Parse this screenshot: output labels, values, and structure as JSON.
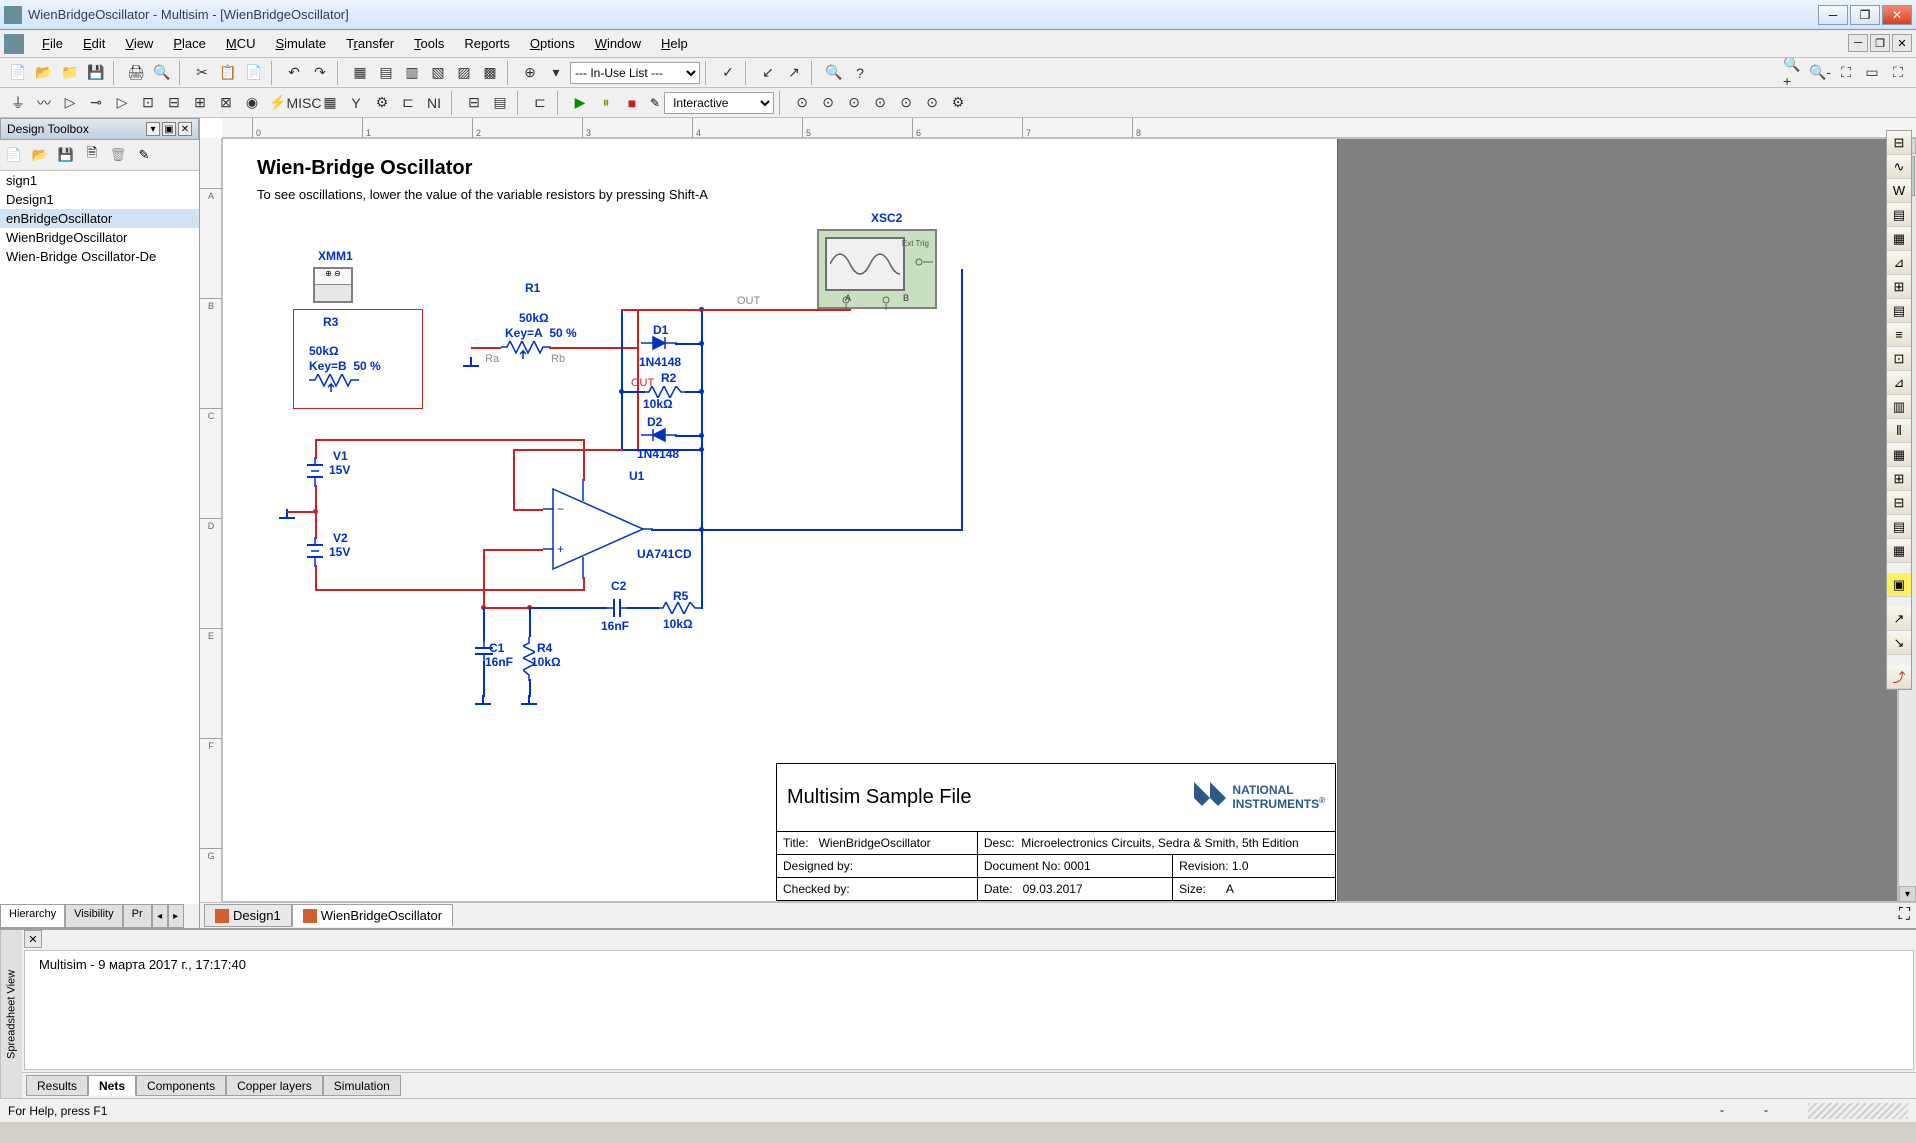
{
  "window": {
    "title": "WienBridgeOscillator - Multisim - [WienBridgeOscillator]"
  },
  "menu": {
    "items": [
      "File",
      "Edit",
      "View",
      "Place",
      "MCU",
      "Simulate",
      "Transfer",
      "Tools",
      "Reports",
      "Options",
      "Window",
      "Help"
    ]
  },
  "toolbar1": {
    "in_use": "--- In-Use List ---"
  },
  "toolbar2": {
    "interactive": "Interactive"
  },
  "sidebar": {
    "title": "Design Toolbox",
    "items": [
      "sign1",
      "Design1",
      "enBridgeOscillator",
      "WienBridgeOscillator",
      "Wien-Bridge Oscillator-De"
    ],
    "selected": 2,
    "tabs": [
      "Hierarchy",
      "Visibility",
      "Pr"
    ]
  },
  "ruler": {
    "h": [
      "0",
      "1",
      "2",
      "3",
      "4",
      "5",
      "6",
      "7",
      "8"
    ],
    "v": [
      "A",
      "B",
      "C",
      "D",
      "E",
      "F",
      "G"
    ]
  },
  "schematic": {
    "title": "Wien-Bridge Oscillator",
    "subtitle": "To see oscillations, lower the value of the variable resistors by pressing Shift-A",
    "components": {
      "XMM1": "XMM1",
      "R1": {
        "name": "R1",
        "val": "50kΩ",
        "key": "Key=A",
        "pct": "50 %"
      },
      "R3": {
        "name": "R3",
        "val": "50kΩ",
        "key": "Key=B",
        "pct": "50 %"
      },
      "D1": {
        "name": "D1",
        "part": "1N4148"
      },
      "D2": {
        "name": "D2",
        "part": "1N4148"
      },
      "R2": {
        "name": "R2",
        "val": "10kΩ"
      },
      "U1": {
        "name": "U1",
        "part": "UA741CD"
      },
      "V1": {
        "name": "V1",
        "val": "15V"
      },
      "V2": {
        "name": "V2",
        "val": "15V"
      },
      "C1": {
        "name": "C1",
        "val": "16nF"
      },
      "C2": {
        "name": "C2",
        "val": "16nF"
      },
      "R4": {
        "name": "R4",
        "val": "10kΩ"
      },
      "R5": {
        "name": "R5",
        "val": "10kΩ"
      },
      "XSC2": "XSC2",
      "netRa": "Ra",
      "netRb": "Rb",
      "netOUT": "OUT",
      "netOUT2": "OUT"
    }
  },
  "titleblock": {
    "sample": "Multisim Sample File",
    "logo": "NATIONAL INSTRUMENTS",
    "r1": {
      "title_l": "Title:",
      "title_v": "WienBridgeOscillator",
      "desc_l": "Desc:",
      "desc_v": "Microelectronics Circuits, Sedra & Smith, 5th Edition"
    },
    "r2": {
      "des_l": "Designed by:",
      "doc_l": "Document No:",
      "doc_v": "0001",
      "rev_l": "Revision:",
      "rev_v": "1.0"
    },
    "r3": {
      "chk_l": "Checked by:",
      "date_l": "Date:",
      "date_v": "09.03.2017",
      "size_l": "Size:",
      "size_v": "A"
    }
  },
  "doctabs": [
    "Design1",
    "WienBridgeOscillator"
  ],
  "spreadsheet": {
    "side": "Spreadsheet View",
    "log": "Multisim  -  9 марта 2017 г., 17:17:40",
    "tabs": [
      "Results",
      "Nets",
      "Components",
      "Copper layers",
      "Simulation"
    ]
  },
  "statusbar": {
    "help": "For Help, press F1",
    "right": [
      "-",
      "-"
    ]
  }
}
